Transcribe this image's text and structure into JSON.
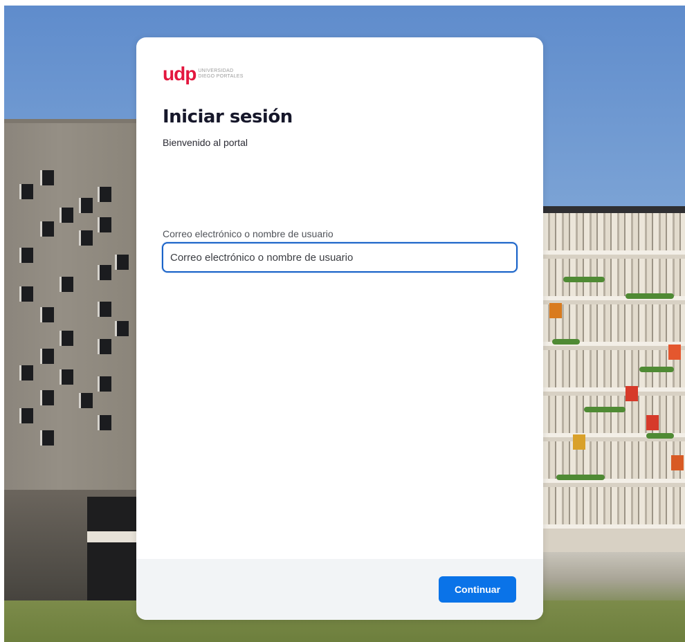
{
  "brand": {
    "logo_mark": "udp",
    "logo_line1": "UNIVERSIDAD",
    "logo_line2": "DIEGO PORTALES",
    "color": "#e3173e"
  },
  "login": {
    "title": "Iniciar sesión",
    "subtitle": "Bienvenido al portal",
    "username_label": "Correo electrónico o nombre de usuario",
    "username_placeholder": "Correo electrónico o nombre de usuario",
    "username_value": "",
    "continue_label": "Continuar"
  },
  "colors": {
    "primary_button": "#0a73e8",
    "input_focus_border": "#1a63c8",
    "footer_bg": "#f2f4f6"
  }
}
